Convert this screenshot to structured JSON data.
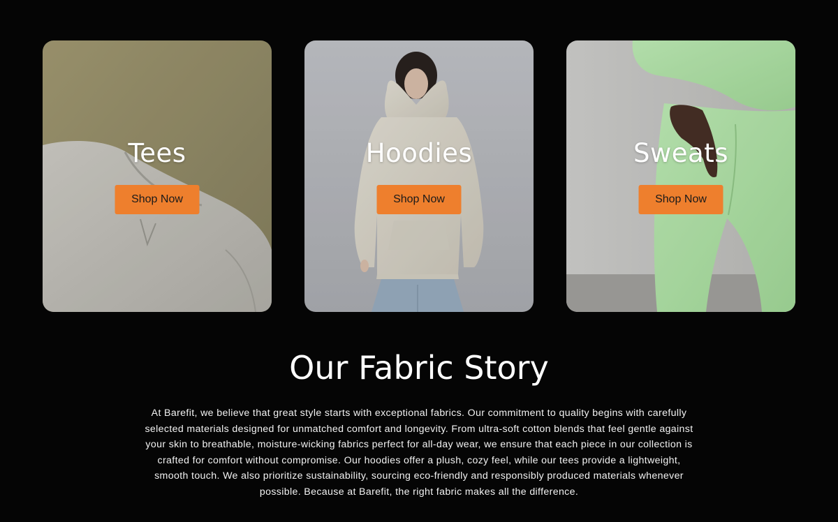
{
  "categories": [
    {
      "title": "Tees",
      "button_label": "Shop Now",
      "photo_icon": "sweatshirt-collar-photo",
      "color": "#c9c7bf"
    },
    {
      "title": "Hoodies",
      "button_label": "Shop Now",
      "photo_icon": "woman-in-hoodie-photo",
      "color": "#ece8dc"
    },
    {
      "title": "Sweats",
      "button_label": "Shop Now",
      "photo_icon": "green-sweatpants-photo",
      "color": "#bff3b6"
    }
  ],
  "accent_color": "#ee7f2d",
  "story": {
    "title": "Our Fabric Story",
    "body": "At Barefit, we believe that great style starts with exceptional fabrics. Our commitment to quality begins with carefully selected materials designed for unmatched comfort and longevity. From ultra-soft cotton blends that feel gentle against your skin to breathable, moisture-wicking fabrics perfect for all-day wear, we ensure that each piece in our collection is crafted for comfort without compromise. Our hoodies offer a plush, cozy feel, while our tees provide a lightweight, smooth touch. We also prioritize sustainability, sourcing eco-friendly and responsibly produced materials whenever possible. Because at Barefit, the right fabric makes all the difference."
  }
}
